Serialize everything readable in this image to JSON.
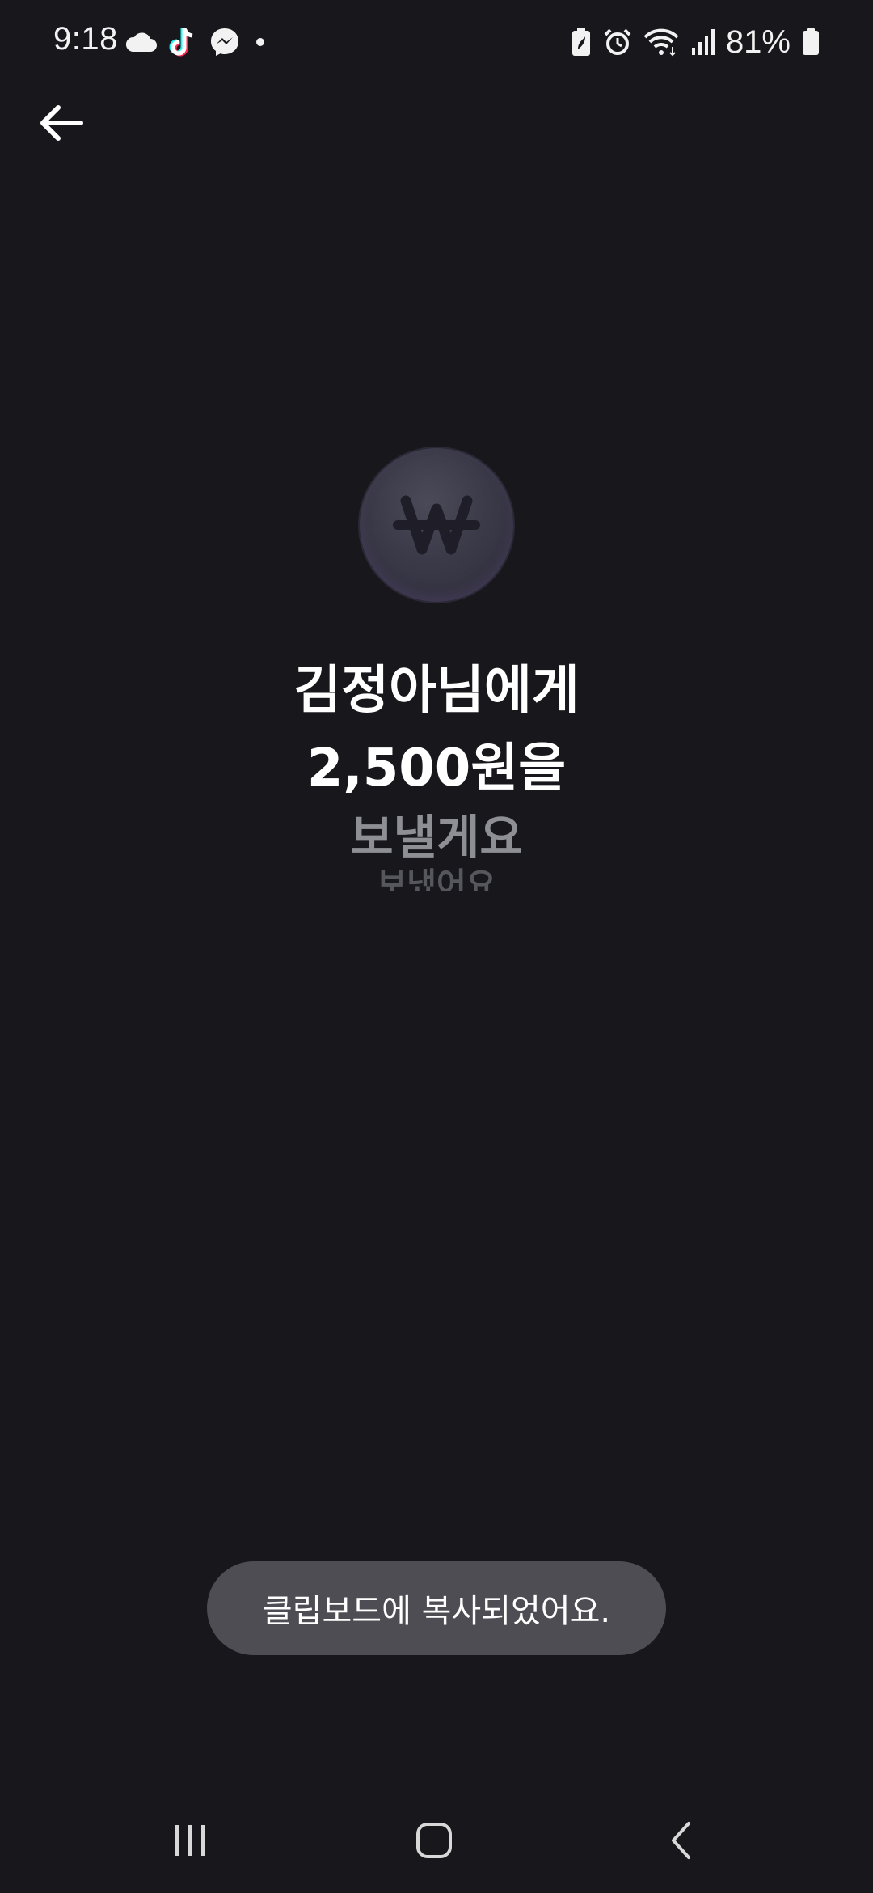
{
  "status_bar": {
    "time": "9:18",
    "battery_percent": "81%",
    "left_icons": [
      "cloud-icon",
      "tiktok-icon",
      "messenger-icon",
      "dot-icon"
    ],
    "right_icons": [
      "battery-saver-icon",
      "alarm-icon",
      "wifi-icon",
      "signal-icon",
      "battery-icon"
    ]
  },
  "header": {
    "back_icon": "arrow-left-icon"
  },
  "transfer": {
    "coin_icon": "won-coin-icon",
    "recipient_line": "김정아님에게",
    "amount_line": "2,500원을",
    "action_line": "보낼게요",
    "next_action_line": "보냈어요"
  },
  "toast": {
    "message": "클립보드에 복사되었어요."
  },
  "nav_bar": {
    "items": [
      "recent-apps-icon",
      "home-icon",
      "back-nav-icon"
    ]
  },
  "colors": {
    "background": "#18171c",
    "toast_background": "#4e4d53",
    "muted_text": "#8e8e95"
  }
}
